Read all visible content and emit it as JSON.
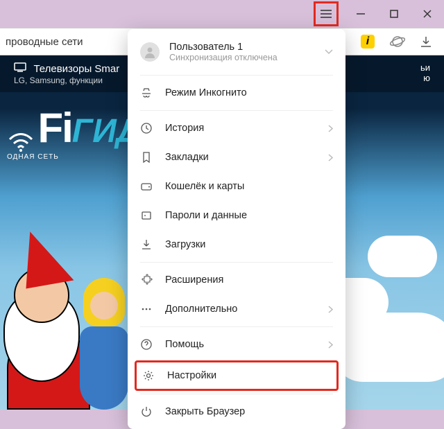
{
  "addressbar": {
    "text": "проводные сети"
  },
  "banner": {
    "tv_line1": "Телевизоры Smar",
    "tv_line2": "LG, Samsung, функции",
    "right1": "ьи",
    "right2": "ю"
  },
  "logo": {
    "fi": "Fi",
    "gid": "ГИД",
    "sub": "ОДНАЯ СЕТЬ"
  },
  "menu": {
    "user_name": "Пользователь 1",
    "user_sub": "Синхронизация отключена",
    "incognito": "Режим Инкогнито",
    "history": "История",
    "bookmarks": "Закладки",
    "wallet": "Кошелёк и карты",
    "passwords": "Пароли и данные",
    "downloads": "Загрузки",
    "extensions": "Расширения",
    "more": "Дополнительно",
    "help": "Помощь",
    "settings": "Настройки",
    "close": "Закрыть Браузер"
  }
}
